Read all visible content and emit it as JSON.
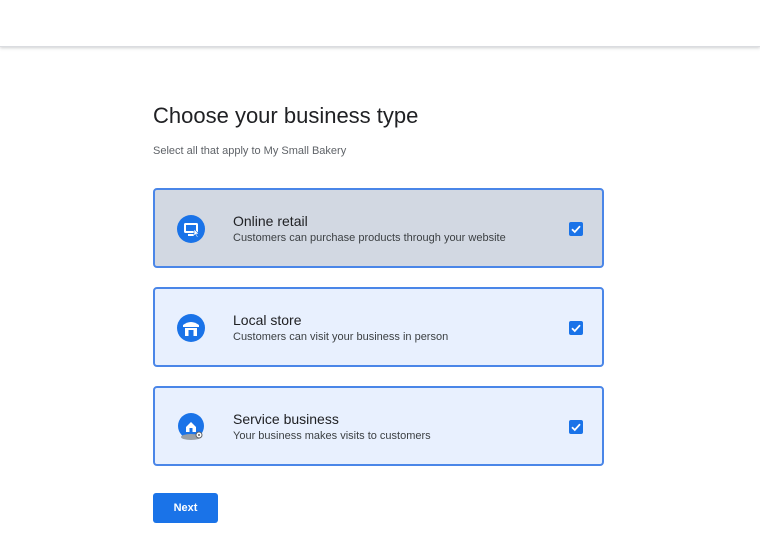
{
  "header": {
    "title": "Choose your business type",
    "subtitle": "Select all that apply to My Small Bakery"
  },
  "options": [
    {
      "title": "Online retail",
      "description": "Customers can purchase products through your website",
      "icon": "online-retail-icon",
      "checked": true
    },
    {
      "title": "Local store",
      "description": "Customers can visit your business in person",
      "icon": "storefront-icon",
      "checked": true
    },
    {
      "title": "Service business",
      "description": "Your business makes visits to customers",
      "icon": "home-location-icon",
      "checked": true
    }
  ],
  "actions": {
    "next_label": "Next"
  },
  "colors": {
    "accent": "#1a73e8",
    "card_border": "#4a86e8",
    "card_background": "#e8f0fe",
    "card_hover_background": "#d2d8e2"
  }
}
